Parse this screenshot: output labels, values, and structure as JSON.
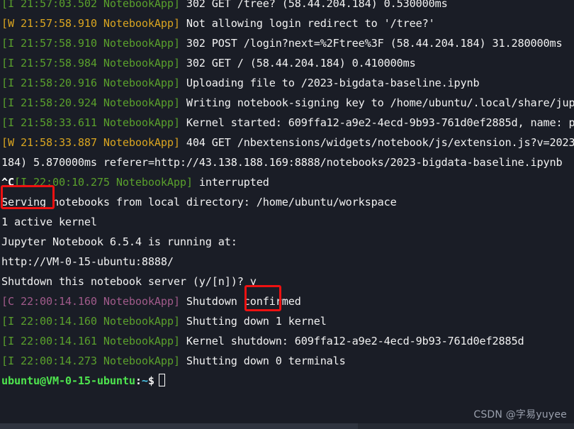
{
  "terminal": {
    "background_color": "#1a1d26",
    "foreground_color": "#f2f2f2",
    "info_color": "#5aa02c",
    "warn_color": "#d9a520",
    "critical_color": "#a05a8a",
    "prompt_user_color": "#4ee44e",
    "prompt_path_color": "#4bc5e8",
    "annotation_color": "#ee1111",
    "lines": [
      {
        "tag": "[I 21:57:03.502 NotebookApp]",
        "level": "info",
        "message": " 302 GET /tree? (58.44.204.184) 0.530000ms"
      },
      {
        "tag": "[W 21:57:58.910 NotebookApp]",
        "level": "warn",
        "message": " Not allowing login redirect to '/tree?'"
      },
      {
        "tag": "[I 21:57:58.910 NotebookApp]",
        "level": "info",
        "message": " 302 POST /login?next=%2Ftree%3F (58.44.204.184) 31.280000ms"
      },
      {
        "tag": "[I 21:57:58.984 NotebookApp]",
        "level": "info",
        "message": " 302 GET / (58.44.204.184) 0.410000ms"
      },
      {
        "tag": "[I 21:58:20.916 NotebookApp]",
        "level": "info",
        "message": " Uploading file to /2023-bigdata-baseline.ipynb"
      },
      {
        "tag": "[I 21:58:20.924 NotebookApp]",
        "level": "info",
        "message": " Writing notebook-signing key to /home/ubuntu/.local/share/jup"
      },
      {
        "tag": "[I 21:58:33.611 NotebookApp]",
        "level": "info",
        "message": " Kernel started: 609ffa12-a9e2-4ecd-9b93-761d0ef2885d, name: p"
      },
      {
        "tag": "[W 21:58:33.887 NotebookApp]",
        "level": "warn",
        "message": " 404 GET /nbextensions/widgets/notebook/js/extension.js?v=2023"
      },
      {
        "tag": "",
        "level": "plain",
        "message": "184) 5.870000ms referer=http://43.138.188.169:8888/notebooks/2023-bigdata-baseline.ipynb"
      },
      {
        "tag": "[I 22:00:10.275 NotebookApp]",
        "level": "info",
        "prefix": "^C",
        "message": " interrupted"
      },
      {
        "tag": "",
        "level": "plain",
        "message": "Serving notebooks from local directory: /home/ubuntu/workspace"
      },
      {
        "tag": "",
        "level": "plain",
        "message": "1 active kernel"
      },
      {
        "tag": "",
        "level": "plain",
        "message": "Jupyter Notebook 6.5.4 is running at:"
      },
      {
        "tag": "",
        "level": "plain",
        "message": "http://VM-0-15-ubuntu:8888/"
      },
      {
        "tag": "",
        "level": "plain",
        "message": "Shutdown this notebook server (y/[n])? y"
      },
      {
        "tag": "[C 22:00:14.160 NotebookApp]",
        "level": "critical",
        "message": " Shutdown confirmed"
      },
      {
        "tag": "[I 22:00:14.160 NotebookApp]",
        "level": "info",
        "message": " Shutting down 1 kernel"
      },
      {
        "tag": "[I 22:00:14.161 NotebookApp]",
        "level": "info",
        "message": " Kernel shutdown: 609ffa12-a9e2-4ecd-9b93-761d0ef2885d"
      },
      {
        "tag": "[I 22:00:14.273 NotebookApp]",
        "level": "info",
        "message": " Shutting down 0 terminals"
      }
    ]
  },
  "prompt": {
    "user_host": "ubuntu@VM-0-15-ubuntu",
    "colon": ":",
    "path": "~",
    "symbol": "$"
  },
  "annotations": [
    {
      "name": "ctrl-c-highlight",
      "target": "^C"
    },
    {
      "name": "confirm-yes-highlight",
      "target": "y"
    }
  ],
  "watermark": {
    "text": "CSDN @字易yuyee"
  },
  "scrollbar": {
    "orientation": "horizontal"
  }
}
